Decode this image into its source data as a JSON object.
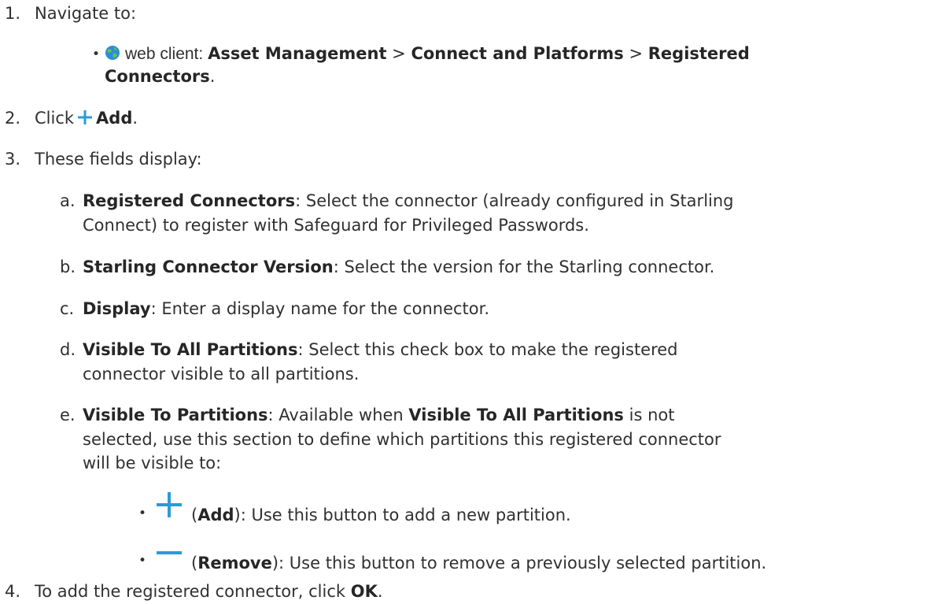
{
  "steps": [
    {
      "n": "1.",
      "text": "Navigate to:"
    },
    {
      "n": "2.",
      "pre": "Click",
      "bold": "Add",
      "post": "."
    },
    {
      "n": "3.",
      "text": "These fields display:"
    },
    {
      "n": "4.",
      "pre": "To add the registered connector, click",
      "bold": "OK",
      "post": "."
    }
  ],
  "nav": {
    "client": "web client: ",
    "p1": "Asset Management",
    "sep1": " > ",
    "p2": "Connect and Platforms",
    "sep2": " > ",
    "p3a": "Registered",
    "p3b": "Connectors",
    "end": "."
  },
  "fields": [
    {
      "letter": "a.",
      "term": "Registered Connectors",
      "line1": ": Select the connector (already configured in Starling",
      "line2": "Connect) to register with Safeguard for Privileged Passwords."
    },
    {
      "letter": "b.",
      "term": "Starling Connector Version",
      "line1": ": Select the version for the Starling connector."
    },
    {
      "letter": "c.",
      "term": "Display",
      "line1": ": Enter a display name for the connector."
    },
    {
      "letter": "d.",
      "term": "Visible To All Partitions",
      "line1": ": Select this check box to make the registered",
      "line2": "connector visible to all partitions."
    },
    {
      "letter": "e.",
      "term": "Visible To Partitions",
      "line1a": ": Available when ",
      "line1b": "Visible To All Partitions",
      "line1c": " is not",
      "line2": "selected, use this section to define which partitions this registered connector",
      "line3": "will be visible to:"
    }
  ],
  "buttons": [
    {
      "open": "(",
      "label": "Add",
      "desc": "): Use this button to add a new partition."
    },
    {
      "open": "(",
      "label": "Remove",
      "desc": "): Use this button to remove a previously selected partition."
    }
  ],
  "bullet": "•",
  "colors": {
    "accent": "#2a9bd7",
    "text": "#333333"
  },
  "icons": [
    "globe-icon",
    "plus-icon",
    "minus-icon"
  ]
}
